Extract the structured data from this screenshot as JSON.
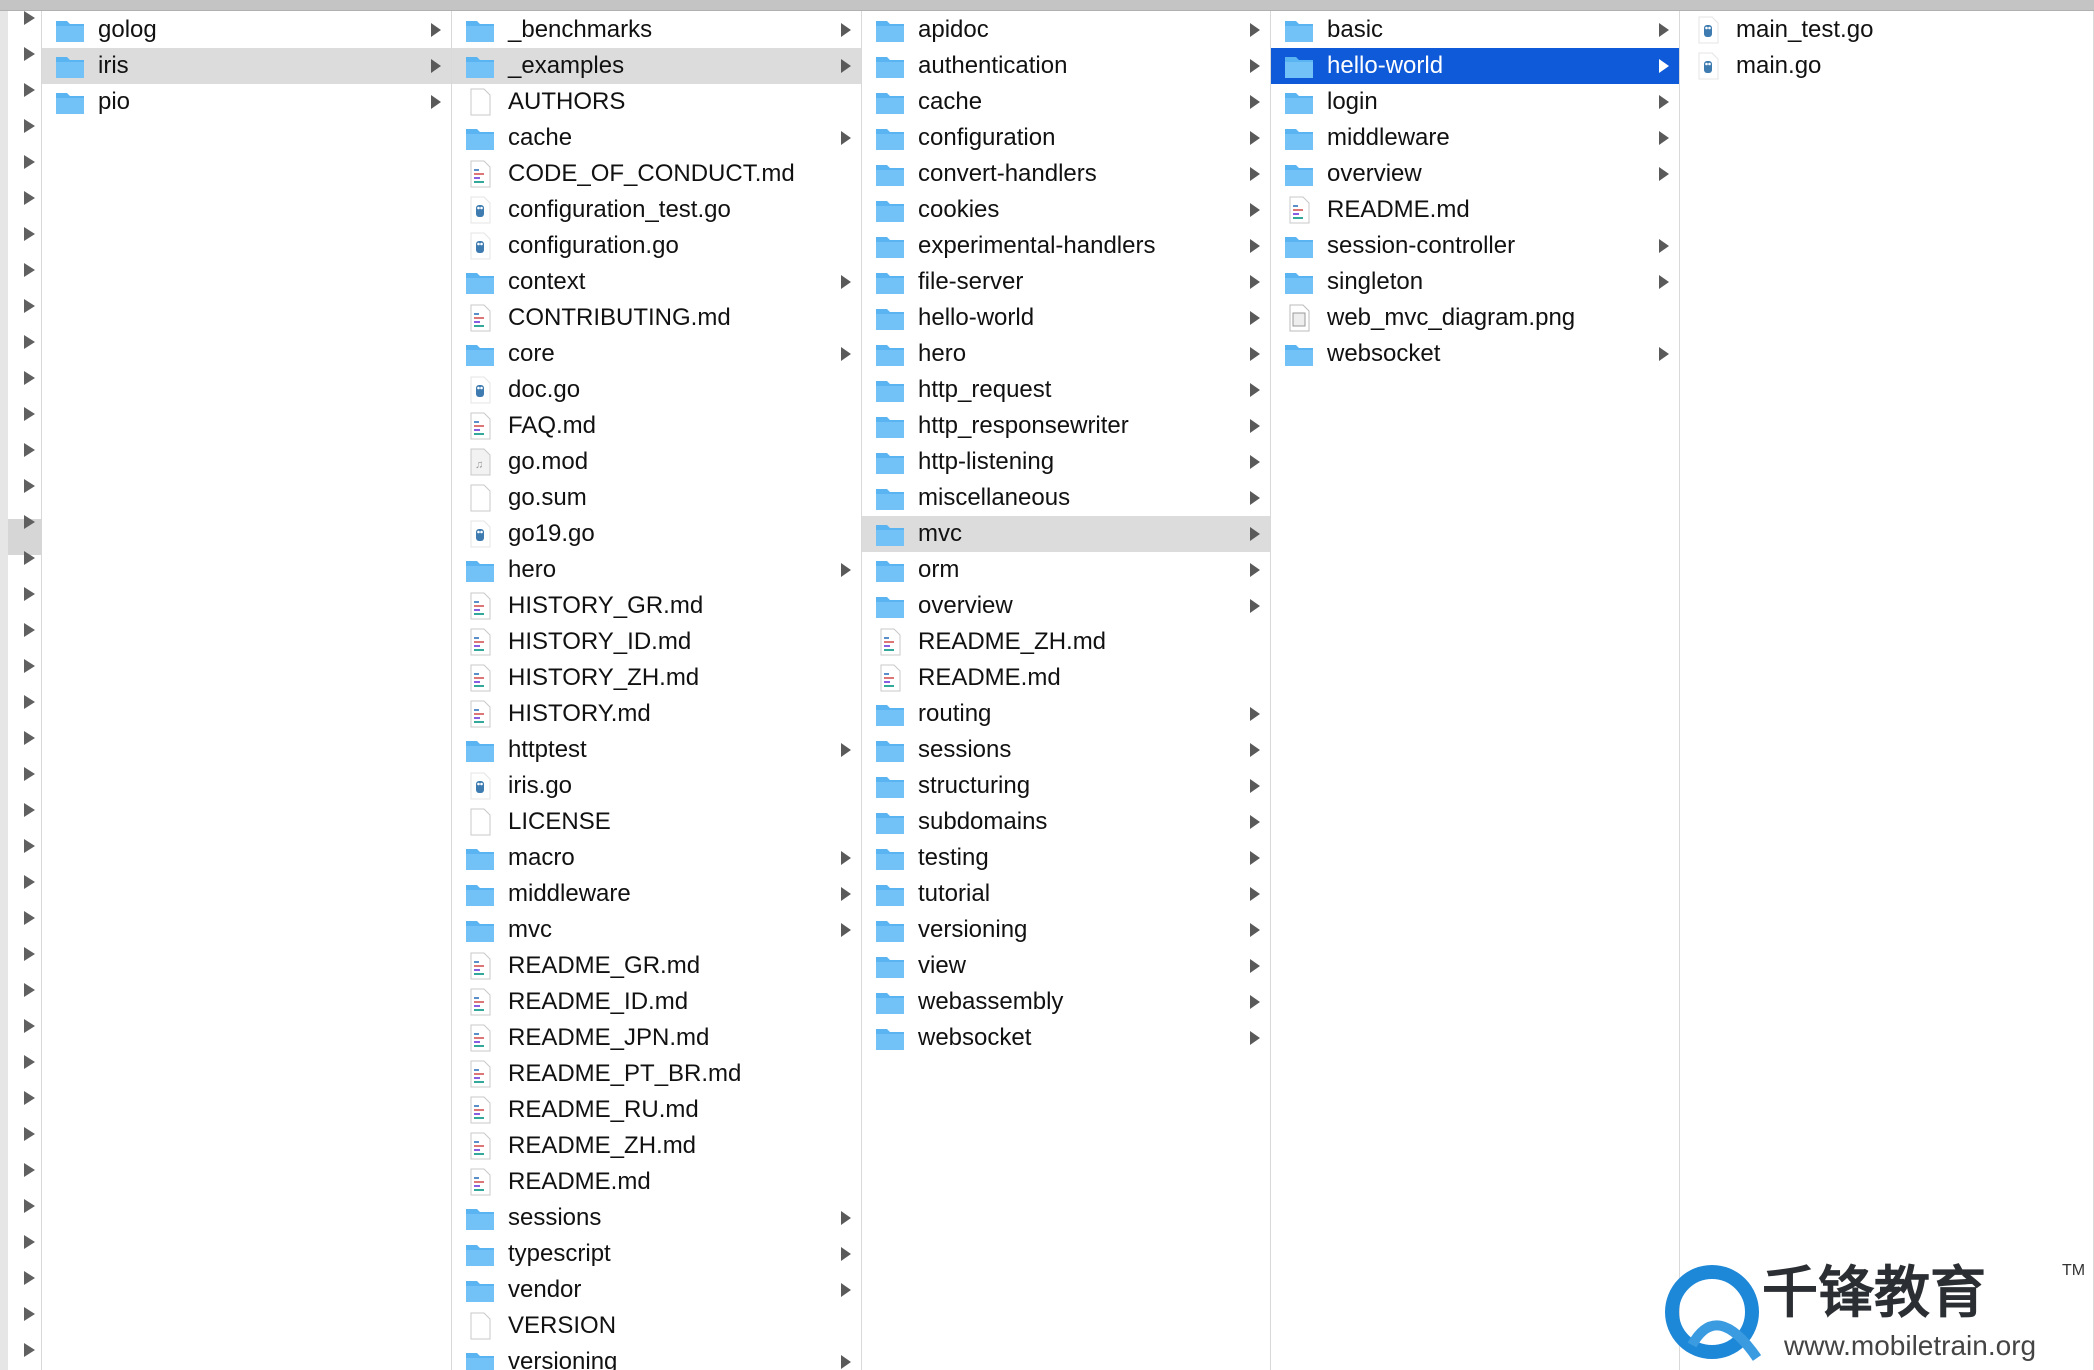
{
  "columns": [
    {
      "items": [
        {
          "name": "golog",
          "type": "folder"
        },
        {
          "name": "iris",
          "type": "folder",
          "selected": "gray"
        },
        {
          "name": "pio",
          "type": "folder"
        }
      ]
    },
    {
      "items": [
        {
          "name": "_benchmarks",
          "type": "folder"
        },
        {
          "name": "_examples",
          "type": "folder",
          "selected": "gray"
        },
        {
          "name": "AUTHORS",
          "type": "file"
        },
        {
          "name": "cache",
          "type": "folder"
        },
        {
          "name": "CODE_OF_CONDUCT.md",
          "type": "md"
        },
        {
          "name": "configuration_test.go",
          "type": "go"
        },
        {
          "name": "configuration.go",
          "type": "go"
        },
        {
          "name": "context",
          "type": "folder"
        },
        {
          "name": "CONTRIBUTING.md",
          "type": "md"
        },
        {
          "name": "core",
          "type": "folder"
        },
        {
          "name": "doc.go",
          "type": "go"
        },
        {
          "name": "FAQ.md",
          "type": "md"
        },
        {
          "name": "go.mod",
          "type": "mod"
        },
        {
          "name": "go.sum",
          "type": "file"
        },
        {
          "name": "go19.go",
          "type": "go"
        },
        {
          "name": "hero",
          "type": "folder"
        },
        {
          "name": "HISTORY_GR.md",
          "type": "md"
        },
        {
          "name": "HISTORY_ID.md",
          "type": "md"
        },
        {
          "name": "HISTORY_ZH.md",
          "type": "md"
        },
        {
          "name": "HISTORY.md",
          "type": "md"
        },
        {
          "name": "httptest",
          "type": "folder"
        },
        {
          "name": "iris.go",
          "type": "go"
        },
        {
          "name": "LICENSE",
          "type": "file"
        },
        {
          "name": "macro",
          "type": "folder"
        },
        {
          "name": "middleware",
          "type": "folder"
        },
        {
          "name": "mvc",
          "type": "folder"
        },
        {
          "name": "README_GR.md",
          "type": "md"
        },
        {
          "name": "README_ID.md",
          "type": "md"
        },
        {
          "name": "README_JPN.md",
          "type": "md"
        },
        {
          "name": "README_PT_BR.md",
          "type": "md"
        },
        {
          "name": "README_RU.md",
          "type": "md"
        },
        {
          "name": "README_ZH.md",
          "type": "md"
        },
        {
          "name": "README.md",
          "type": "md"
        },
        {
          "name": "sessions",
          "type": "folder"
        },
        {
          "name": "typescript",
          "type": "folder"
        },
        {
          "name": "vendor",
          "type": "folder"
        },
        {
          "name": "VERSION",
          "type": "file"
        },
        {
          "name": "versioning",
          "type": "folder"
        }
      ]
    },
    {
      "items": [
        {
          "name": "apidoc",
          "type": "folder"
        },
        {
          "name": "authentication",
          "type": "folder"
        },
        {
          "name": "cache",
          "type": "folder"
        },
        {
          "name": "configuration",
          "type": "folder"
        },
        {
          "name": "convert-handlers",
          "type": "folder"
        },
        {
          "name": "cookies",
          "type": "folder"
        },
        {
          "name": "experimental-handlers",
          "type": "folder"
        },
        {
          "name": "file-server",
          "type": "folder"
        },
        {
          "name": "hello-world",
          "type": "folder"
        },
        {
          "name": "hero",
          "type": "folder"
        },
        {
          "name": "http_request",
          "type": "folder"
        },
        {
          "name": "http_responsewriter",
          "type": "folder"
        },
        {
          "name": "http-listening",
          "type": "folder"
        },
        {
          "name": "miscellaneous",
          "type": "folder"
        },
        {
          "name": "mvc",
          "type": "folder",
          "selected": "gray"
        },
        {
          "name": "orm",
          "type": "folder"
        },
        {
          "name": "overview",
          "type": "folder"
        },
        {
          "name": "README_ZH.md",
          "type": "md"
        },
        {
          "name": "README.md",
          "type": "md"
        },
        {
          "name": "routing",
          "type": "folder"
        },
        {
          "name": "sessions",
          "type": "folder"
        },
        {
          "name": "structuring",
          "type": "folder"
        },
        {
          "name": "subdomains",
          "type": "folder"
        },
        {
          "name": "testing",
          "type": "folder"
        },
        {
          "name": "tutorial",
          "type": "folder"
        },
        {
          "name": "versioning",
          "type": "folder"
        },
        {
          "name": "view",
          "type": "folder"
        },
        {
          "name": "webassembly",
          "type": "folder"
        },
        {
          "name": "websocket",
          "type": "folder"
        }
      ]
    },
    {
      "items": [
        {
          "name": "basic",
          "type": "folder"
        },
        {
          "name": "hello-world",
          "type": "folder",
          "selected": "blue"
        },
        {
          "name": "login",
          "type": "folder"
        },
        {
          "name": "middleware",
          "type": "folder"
        },
        {
          "name": "overview",
          "type": "folder"
        },
        {
          "name": "README.md",
          "type": "md"
        },
        {
          "name": "session-controller",
          "type": "folder"
        },
        {
          "name": "singleton",
          "type": "folder"
        },
        {
          "name": "web_mvc_diagram.png",
          "type": "png"
        },
        {
          "name": "websocket",
          "type": "folder"
        }
      ]
    },
    {
      "items": [
        {
          "name": "main_test.go",
          "type": "go"
        },
        {
          "name": "main.go",
          "type": "go"
        }
      ]
    }
  ],
  "watermark": {
    "brand": "千锋教育",
    "url": "www.mobiletrain.org",
    "tm": "TM"
  },
  "colors": {
    "selection_blue": "#0f5ad9",
    "selection_gray": "#dcdcdc",
    "folder": "#5ab4f2"
  }
}
